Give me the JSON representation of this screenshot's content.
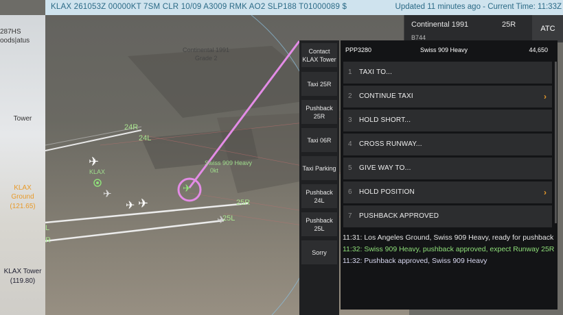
{
  "topbar": {
    "metar": "KLAX 261053Z 00000KT 7SM CLR 10/09 A3009 RMK AO2 SLP188 T01000089 $",
    "updated": "Updated 11 minutes ago - Current Time: 11:33Z"
  },
  "leftpanel": {
    "top_text_1": "287HS",
    "top_text_2": "oods|atus",
    "tower": "Tower",
    "ground_name": "KLAX",
    "ground_role": "Ground",
    "ground_freq": "(121.65)",
    "tower_name": "KLAX Tower",
    "tower_freq": "(119.80)"
  },
  "scene": {
    "gate_label_1": "Continental 1991",
    "gate_label_2": "Grade 2",
    "rwy_24r": "24R",
    "rwy_24l": "24L",
    "rwy_25r": "25R",
    "rwy_25l": "25L",
    "edge_l": "L",
    "edge_r": "R",
    "airport": "KLAX",
    "aircraft_callsign": "Swiss 909 Heavy",
    "aircraft_speed": "0kt"
  },
  "strip": {
    "row1_callsign": "Continental 1991",
    "row1_runway": "25R",
    "row2_type": "B744",
    "atc_label": "ATC"
  },
  "side_buttons": [
    {
      "label": "Contact KLAX Tower"
    },
    {
      "label": "Taxi 25R"
    },
    {
      "label": "Pushback 25R"
    },
    {
      "label": "Taxi 06R"
    },
    {
      "label": "Taxi Parking"
    },
    {
      "label": "Pushback 24L"
    },
    {
      "label": "Pushback 25L"
    },
    {
      "label": "Sorry"
    }
  ],
  "menu": {
    "header_id": "PPP3280",
    "header_callsign": "Swiss 909 Heavy",
    "header_value": "44,650",
    "items": [
      {
        "num": "1",
        "label": "TAXI TO...",
        "chevron": ""
      },
      {
        "num": "2",
        "label": "CONTINUE TAXI",
        "chevron": "›"
      },
      {
        "num": "3",
        "label": "HOLD SHORT...",
        "chevron": ""
      },
      {
        "num": "4",
        "label": "CROSS RUNWAY...",
        "chevron": ""
      },
      {
        "num": "5",
        "label": "GIVE WAY TO...",
        "chevron": ""
      },
      {
        "num": "6",
        "label": "HOLD POSITION",
        "chevron": "›"
      },
      {
        "num": "7",
        "label": "PUSHBACK APPROVED",
        "chevron": ""
      }
    ]
  },
  "log": [
    {
      "text": "11:31: Los Angeles Ground, Swiss 909 Heavy, ready for pushback",
      "color": "#e6e6e6"
    },
    {
      "text": "11:32: Swiss 909 Heavy, pushback approved, expect Runway 25R",
      "color": "#8fe07a"
    },
    {
      "text": "11:32: Pushback approved, Swiss 909 Heavy",
      "color": "#d8d8f0"
    }
  ],
  "colors": {
    "accent_orange": "#e89a2a",
    "selection_pink": "#e38ce6",
    "ground_green": "#8fe07a"
  }
}
